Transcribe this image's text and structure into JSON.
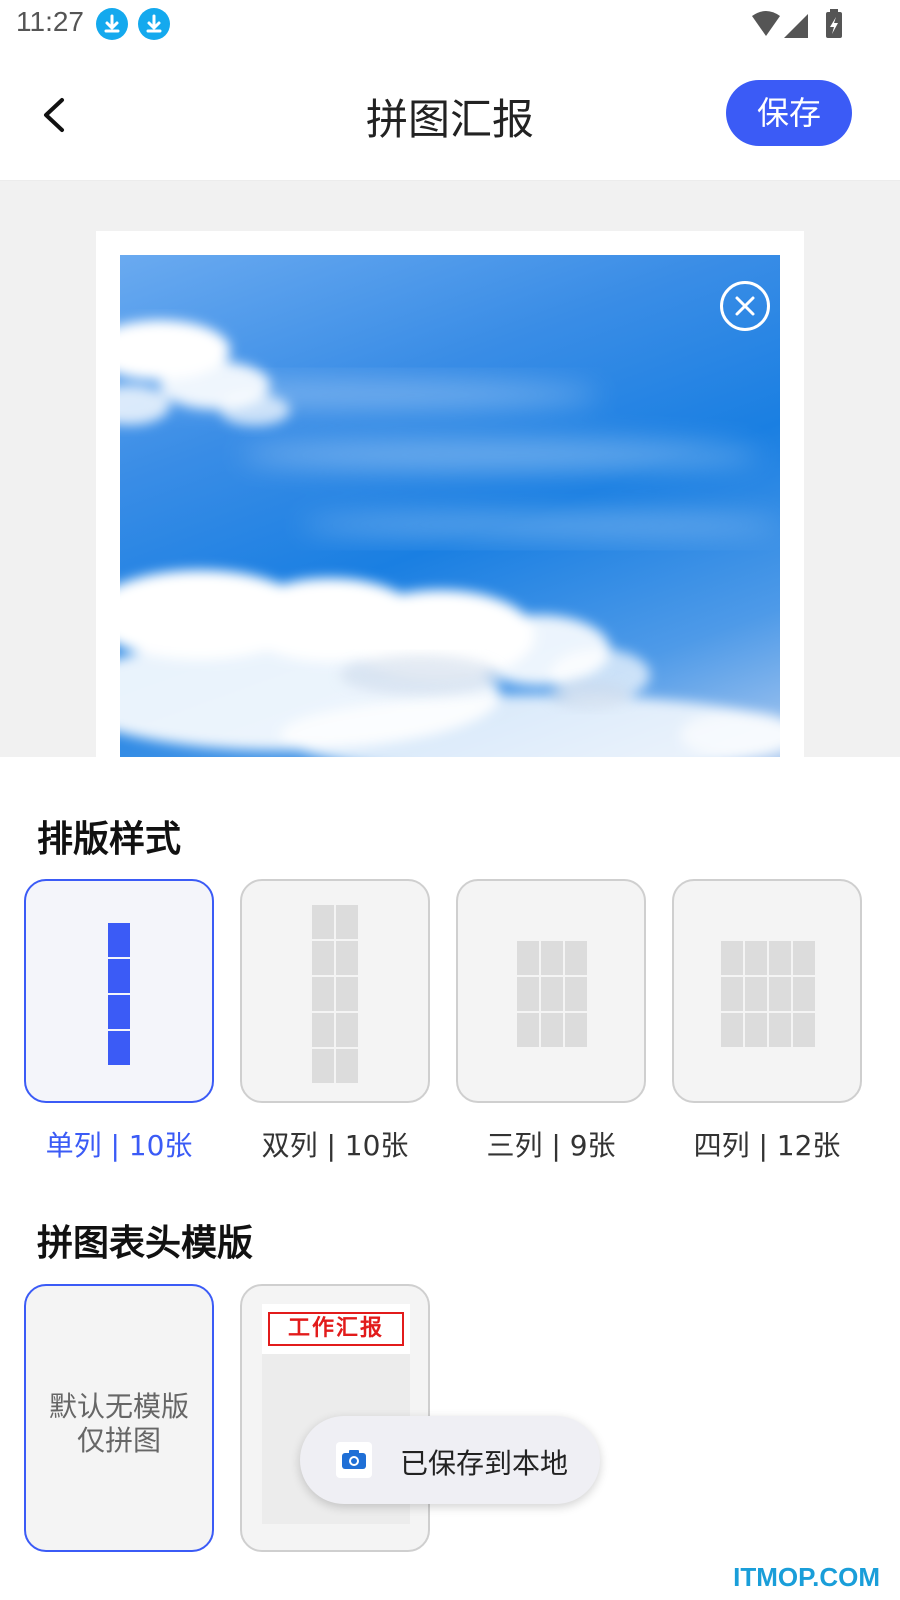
{
  "status_bar": {
    "time": "11:27",
    "icons": [
      "download-icon",
      "download-icon",
      "wifi-icon",
      "signal-icon",
      "battery-charging-icon"
    ]
  },
  "app_bar": {
    "title": "拼图汇报",
    "save_label": "保存",
    "back_icon": "chevron-left-icon"
  },
  "preview": {
    "remove_icon": "close-circle-icon"
  },
  "layout_section": {
    "title": "排版样式",
    "options": [
      {
        "label": "单列 | 10张",
        "selected": true
      },
      {
        "label": "双列 | 10张",
        "selected": false
      },
      {
        "label": "三列 | 9张",
        "selected": false
      },
      {
        "label": "四列 | 12张",
        "selected": false
      }
    ]
  },
  "template_section": {
    "title": "拼图表头模版",
    "default_line1": "默认无模版",
    "default_line2": "仅拼图",
    "work_report_header": "工作汇报"
  },
  "toast": {
    "text": "已保存到本地"
  },
  "watermark": "ITMOP.COM",
  "colors": {
    "accent": "#3b5bf6",
    "red": "#e21b1b",
    "download": "#14a9ee"
  }
}
